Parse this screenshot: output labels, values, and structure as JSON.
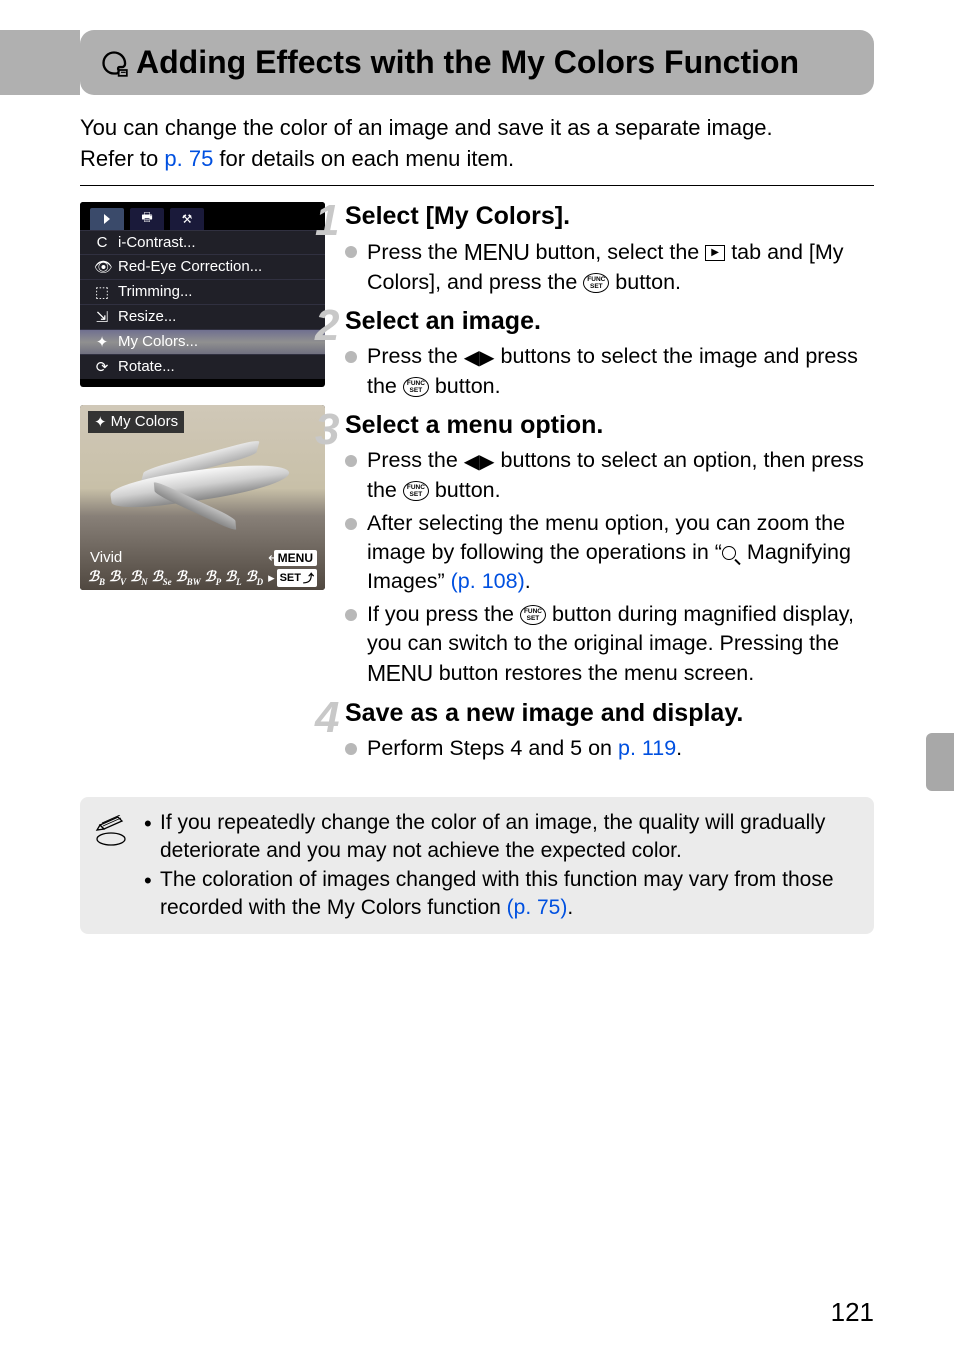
{
  "header": {
    "title": "Adding Effects with the My Colors Function"
  },
  "intro": {
    "line1": "You can change the color of an image and save it as a separate image.",
    "line2_a": "Refer to ",
    "line2_link": "p. 75",
    "line2_b": " for details on each menu item."
  },
  "menu_screenshot": {
    "items": [
      {
        "icon": "C",
        "label": "i-Contrast..."
      },
      {
        "icon": "👁",
        "label": "Red-Eye Correction..."
      },
      {
        "icon": "⬚",
        "label": "Trimming..."
      },
      {
        "icon": "⇲",
        "label": "Resize..."
      },
      {
        "icon": "✦",
        "label": "My Colors...",
        "highlighted": true
      },
      {
        "icon": "⟳",
        "label": "Rotate..."
      }
    ]
  },
  "vivid_screenshot": {
    "title": "My Colors",
    "label": "Vivid",
    "menu_label": "MENU",
    "set_label": "SET",
    "icons": [
      "B",
      "V",
      "N",
      "Se",
      "BW",
      "P",
      "L",
      "D"
    ]
  },
  "steps": [
    {
      "num": "1",
      "title": "Select [My Colors].",
      "bullets": [
        {
          "parts": [
            "Press the ",
            "{MENU}",
            " button, select the ",
            "{PLAYTAB}",
            " tab and [My Colors], and press the ",
            "{FUNC}",
            " button."
          ]
        }
      ]
    },
    {
      "num": "2",
      "title": "Select an image.",
      "bullets": [
        {
          "parts": [
            "Press the ",
            "{LR}",
            " buttons to select the image and press the ",
            "{FUNC}",
            " button."
          ]
        }
      ]
    },
    {
      "num": "3",
      "title": "Select a menu option.",
      "bullets": [
        {
          "parts": [
            "Press the ",
            "{LR}",
            " buttons to select an option, then press the ",
            "{FUNC}",
            " button."
          ]
        },
        {
          "parts": [
            "After selecting the menu option, you can zoom the image by following the operations in “",
            "{MAG}",
            " Magnifying Images” ",
            "{LINK:(p. 108)}",
            "."
          ]
        },
        {
          "parts": [
            "If you press the ",
            "{FUNC}",
            " button during magnified display, you can switch to the original image. Pressing the ",
            "{MENU}",
            " button restores the menu screen."
          ]
        }
      ]
    },
    {
      "num": "4",
      "title": "Save as a new image and display.",
      "bullets": [
        {
          "parts": [
            "Perform Steps 4 and 5 on ",
            "{LINK:p. 119}",
            "."
          ]
        }
      ]
    }
  ],
  "notes": [
    "If you repeatedly change the color of an image, the quality will gradually deteriorate and you may not achieve the expected color.",
    {
      "text_a": "The coloration of images changed with this function may vary from those recorded with the My Colors function ",
      "link": "(p. 75)",
      "text_b": "."
    }
  ],
  "page_number": "121"
}
